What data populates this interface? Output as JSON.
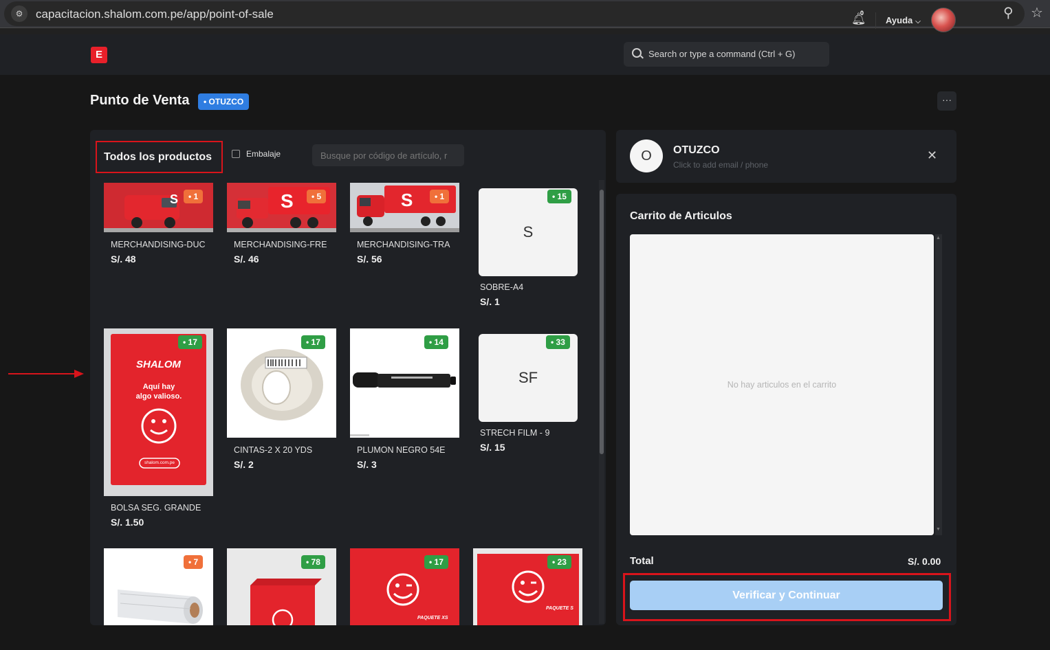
{
  "browser": {
    "url": "capacitacion.shalom.com.pe/app/point-of-sale",
    "site_info_icon": "tune-icon",
    "zoom_icon": "zoom-icon",
    "bookmark_icon": "star-icon"
  },
  "navbar": {
    "logo_letter": "E",
    "search_placeholder": "Search or type a command (Ctrl + G)",
    "notifications_count": "0",
    "help_label": "Ayuda"
  },
  "page": {
    "title": "Punto de Venta",
    "branch_badge": "• OTUZCO",
    "more_label": "···"
  },
  "products": {
    "filter_label": "Todos los productos",
    "packaging_label": "Embalaje",
    "search_placeholder": "Busque por código de artículo, r",
    "items": [
      {
        "name": "MERCHANDISING-DUC",
        "price": "S/. 48",
        "stock": "• 1",
        "stock_color": "#f0703a",
        "image": "red-van-toy"
      },
      {
        "name": "MERCHANDISING-FRE",
        "price": "S/. 46",
        "stock": "• 5",
        "stock_color": "#f0703a",
        "image": "red-truck-toy"
      },
      {
        "name": "MERCHANDISING-TRA",
        "price": "S/. 56",
        "stock": "• 1",
        "stock_color": "#f0703a",
        "image": "red-trailer-toy"
      },
      {
        "name": "SOBRE-A4",
        "price": "S/. 1",
        "stock": "• 15",
        "stock_color": "#2f9e45",
        "initial": "S"
      },
      {
        "name": "BOLSA SEG. GRANDE",
        "price": "S/. 1.50",
        "stock": "• 17",
        "stock_color": "#2f9e45",
        "image": "red-security-bag",
        "bag_brand": "SHALOM",
        "bag_slogan": "Aquí hay algo valioso.",
        "bag_site": "shalom.com.pe"
      },
      {
        "name": "CINTAS-2 X 20 YDS",
        "price": "S/. 2",
        "stock": "• 17",
        "stock_color": "#2f9e45",
        "image": "packing-tape"
      },
      {
        "name": "PLUMON NEGRO 54E",
        "price": "S/. 3",
        "stock": "• 14",
        "stock_color": "#2f9e45",
        "image": "black-marker"
      },
      {
        "name": "STRECH FILM - 9",
        "price": "S/. 15",
        "stock": "• 33",
        "stock_color": "#2f9e45",
        "initial": "SF"
      },
      {
        "stock": "• 7",
        "stock_color": "#f0703a",
        "image": "stretch-film-roll"
      },
      {
        "stock": "• 78",
        "stock_color": "#2f9e45",
        "image": "red-box"
      },
      {
        "stock": "• 17",
        "stock_color": "#2f9e45",
        "image": "red-box-xs",
        "box_label": "PAQUETE XS"
      },
      {
        "stock": "• 23",
        "stock_color": "#2f9e45",
        "image": "red-box-s",
        "box_label": "PAQUETE S"
      }
    ]
  },
  "customer": {
    "initial": "O",
    "name": "OTUZCO",
    "hint": "Click to add email / phone"
  },
  "cart": {
    "title": "Carrito de Articulos",
    "empty_message": "No hay articulos en el carrito",
    "total_label": "Total",
    "total_value": "S/. 0.00",
    "checkout_label": "Verificar y Continuar"
  },
  "colors": {
    "accent_red": "#d9141b",
    "badge_blue": "#2f7de1",
    "checkout_blue": "#a8cff5"
  }
}
